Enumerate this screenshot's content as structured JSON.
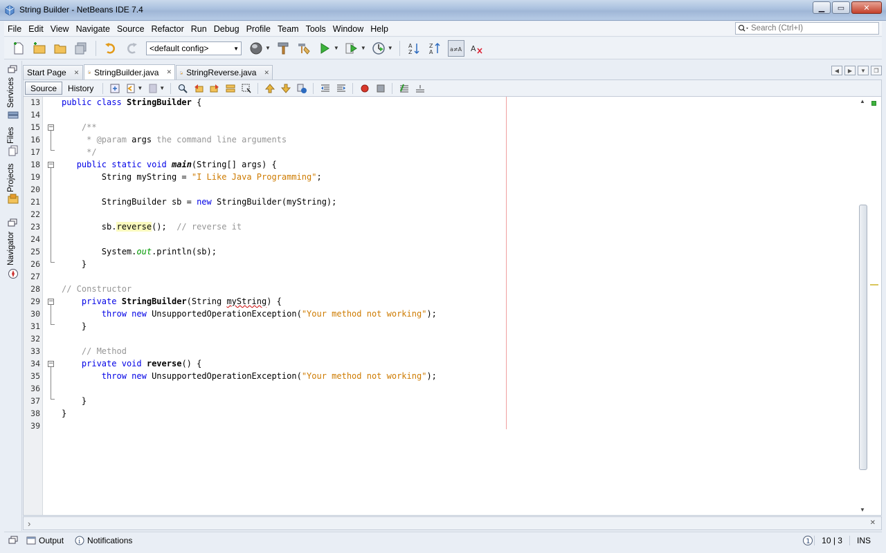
{
  "window": {
    "title": "String Builder - NetBeans IDE 7.4"
  },
  "menu": [
    "File",
    "Edit",
    "View",
    "Navigate",
    "Source",
    "Refactor",
    "Run",
    "Debug",
    "Profile",
    "Team",
    "Tools",
    "Window",
    "Help"
  ],
  "search": {
    "placeholder": "Search (Ctrl+I)"
  },
  "toolbar": {
    "config": "<default config>"
  },
  "side_tabs": {
    "services": "Services",
    "files": "Files",
    "projects": "Projects",
    "navigator": "Navigator"
  },
  "tabs": [
    {
      "label": "Start Page",
      "active": false
    },
    {
      "label": "StringBuilder.java",
      "active": true
    },
    {
      "label": "StringReverse.java",
      "active": false
    }
  ],
  "editor_toolbar": {
    "source": "Source",
    "history": "History"
  },
  "code": {
    "lines": [
      {
        "n": "13",
        "html": "<span class='kw'>public</span> <span class='kw'>class</span> <span class='bold'>StringBuilder</span> {"
      },
      {
        "n": "14",
        "html": ""
      },
      {
        "n": "15",
        "html": "    <span class='cmt'>/**</span>"
      },
      {
        "n": "16",
        "html": "     <span class='cmt'>* @param </span>args<span class='cmt'> the command line arguments</span>"
      },
      {
        "n": "17",
        "html": "     <span class='cmt'>*/</span>"
      },
      {
        "n": "18",
        "html": "   <span class='kw'>public</span> <span class='kw'>static</span> <span class='kw'>void</span> <span class='ital'>main</span>(String[] args) {"
      },
      {
        "n": "19",
        "html": "        String myString = <span class='str'>\"I Like Java Programming\"</span>;"
      },
      {
        "n": "20",
        "html": ""
      },
      {
        "n": "21",
        "html": "        StringBuilder sb = <span class='kw'>new</span> StringBuilder(myString);"
      },
      {
        "n": "22",
        "html": ""
      },
      {
        "n": "23",
        "html": "        sb.<span class='hl'>reverse</span>();  <span class='cmt'>// reverse it</span>"
      },
      {
        "n": "24",
        "html": ""
      },
      {
        "n": "25",
        "html": "        System.<span class='fld'>out</span>.println(sb);"
      },
      {
        "n": "26",
        "html": "    }"
      },
      {
        "n": "27",
        "html": ""
      },
      {
        "n": "28",
        "html": "<span class='cmt'>// Constructor</span>"
      },
      {
        "n": "29",
        "html": "    <span class='kw'>private</span> <span class='bold'>StringBuilder</span>(String <span class='squig'>myString</span>) {"
      },
      {
        "n": "30",
        "html": "        <span class='kw'>throw</span> <span class='kw'>new</span> UnsupportedOperationException(<span class='str'>\"Your method not working\"</span>);"
      },
      {
        "n": "31",
        "html": "    }"
      },
      {
        "n": "32",
        "html": ""
      },
      {
        "n": "33",
        "html": "    <span class='cmt'>// Method</span>"
      },
      {
        "n": "34",
        "html": "    <span class='kw'>private</span> <span class='kw'>void</span> <span class='bold'>reverse</span>() {"
      },
      {
        "n": "35",
        "html": "        <span class='kw'>throw</span> <span class='kw'>new</span> UnsupportedOperationException(<span class='str'>\"Your method not working\"</span>);"
      },
      {
        "n": "36",
        "html": ""
      },
      {
        "n": "37",
        "html": "    }"
      },
      {
        "n": "38",
        "html": "}"
      },
      {
        "n": "39",
        "html": ""
      }
    ]
  },
  "status": {
    "output": "Output",
    "notifications": "Notifications",
    "position": "10 | 3",
    "mode": "INS",
    "badge": "1"
  }
}
